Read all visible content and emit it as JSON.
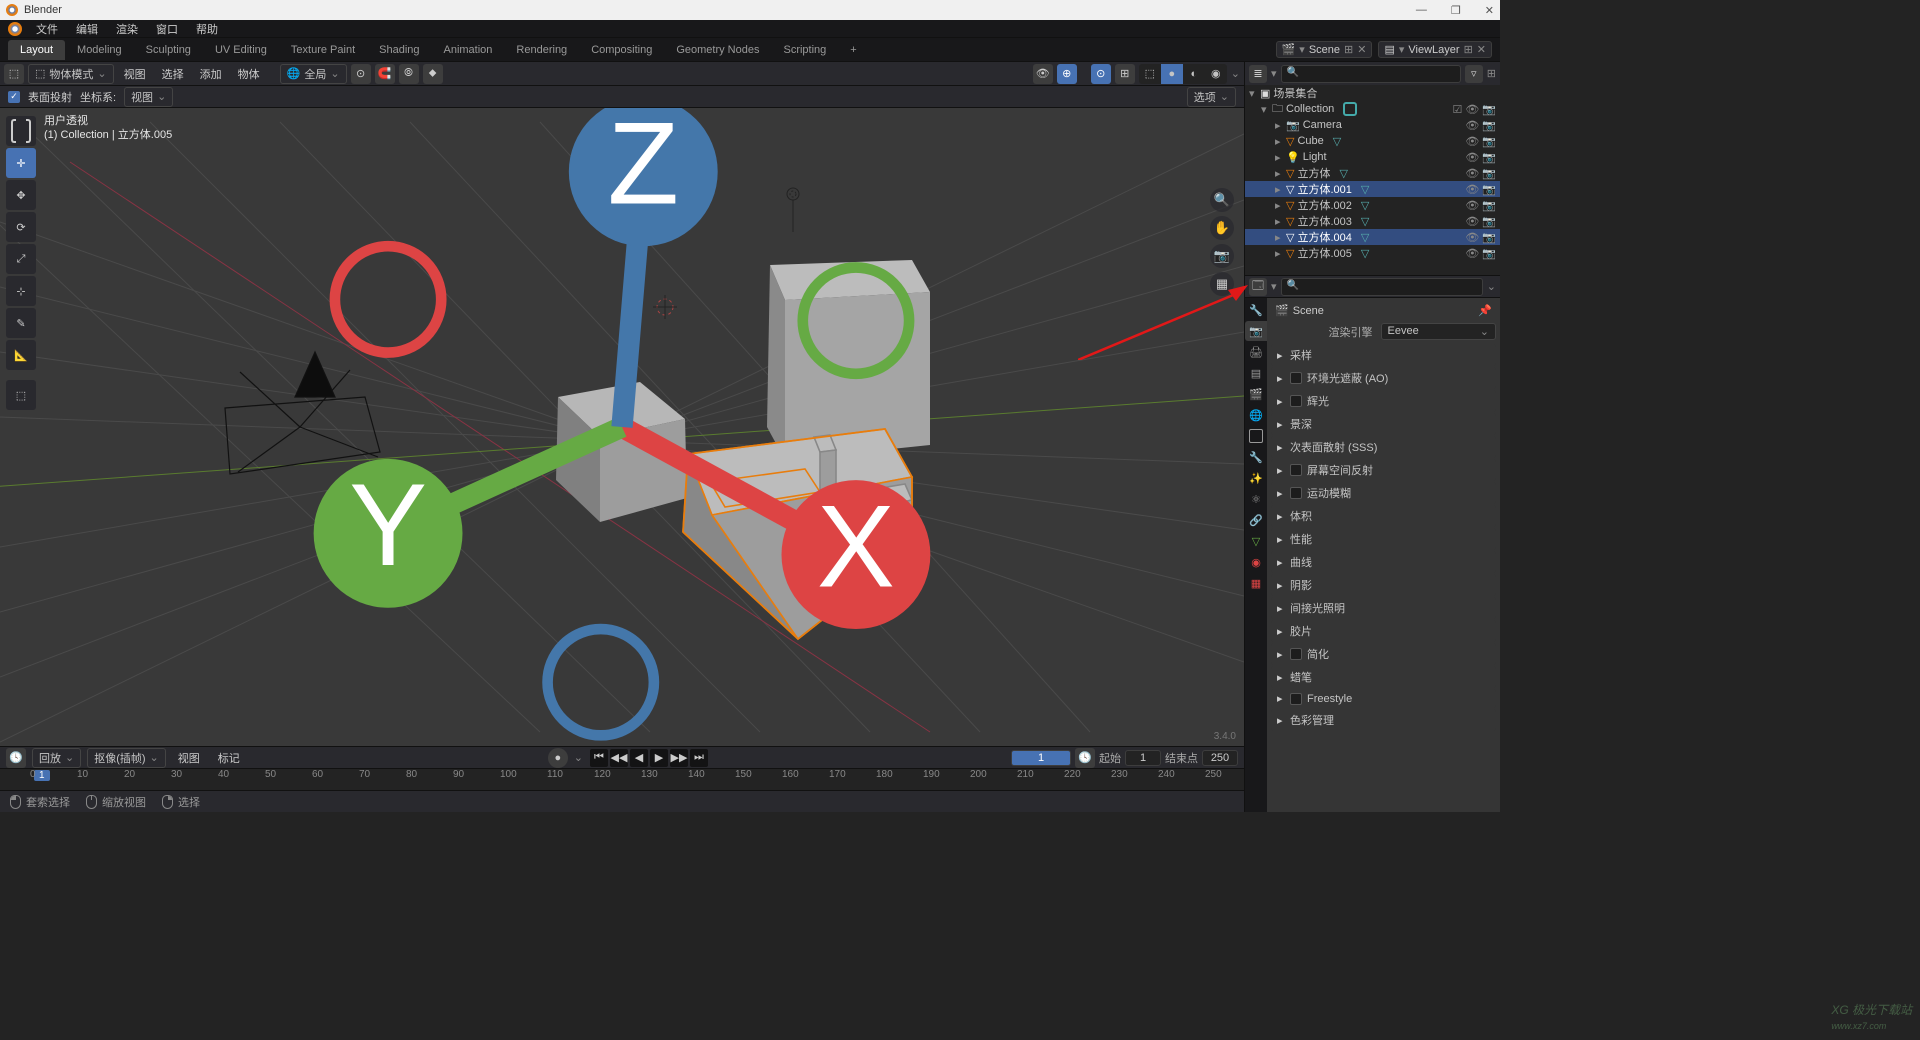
{
  "app_title": "Blender",
  "main_menu": [
    "文件",
    "编辑",
    "渲染",
    "窗口",
    "帮助"
  ],
  "workspace_tabs": {
    "active": "Layout",
    "items": [
      "Layout",
      "Modeling",
      "Sculpting",
      "UV Editing",
      "Texture Paint",
      "Shading",
      "Animation",
      "Rendering",
      "Compositing",
      "Geometry Nodes",
      "Scripting"
    ]
  },
  "scene_name": "Scene",
  "view_layer": "ViewLayer",
  "viewport_header": {
    "mode": "物体模式",
    "menus": [
      "视图",
      "选择",
      "添加",
      "物体"
    ],
    "orientation": "全局"
  },
  "viewport_opts": {
    "project_surface": "表面投射",
    "coord_label": "坐标系:",
    "coord_value": "视图",
    "options_label": "选项"
  },
  "toolbar": [
    "select-box",
    "cursor",
    "move",
    "rotate",
    "scale",
    "transform",
    "annotate",
    "measure",
    "add-primitive"
  ],
  "viewport_info": {
    "line1": "用户透视",
    "line2": "(1) Collection | 立方体.005"
  },
  "gizmo_axes": {
    "x": "X",
    "y": "Y",
    "z": "Z"
  },
  "outliner": {
    "root": "场景集合",
    "collection": "Collection",
    "items": [
      {
        "name": "Camera",
        "type": "camera",
        "selected": false
      },
      {
        "name": "Cube",
        "type": "mesh",
        "selected": false
      },
      {
        "name": "Light",
        "type": "light",
        "selected": false
      },
      {
        "name": "立方体",
        "type": "mesh",
        "selected": false
      },
      {
        "name": "立方体.001",
        "type": "mesh",
        "selected": true
      },
      {
        "name": "立方体.002",
        "type": "mesh",
        "selected": false
      },
      {
        "name": "立方体.003",
        "type": "mesh",
        "selected": false
      },
      {
        "name": "立方体.004",
        "type": "mesh",
        "selected": true
      },
      {
        "name": "立方体.005",
        "type": "mesh",
        "selected": false
      }
    ]
  },
  "properties": {
    "breadcrumb": "Scene",
    "render_engine_label": "渲染引擎",
    "render_engine_value": "Eevee",
    "panels": [
      {
        "label": "采样",
        "check": false
      },
      {
        "label": "环境光遮蔽 (AO)",
        "check": true
      },
      {
        "label": "辉光",
        "check": true
      },
      {
        "label": "景深",
        "check": false
      },
      {
        "label": "次表面散射 (SSS)",
        "check": false
      },
      {
        "label": "屏幕空间反射",
        "check": true
      },
      {
        "label": "运动模糊",
        "check": true
      },
      {
        "label": "体积",
        "check": false
      },
      {
        "label": "性能",
        "check": false
      },
      {
        "label": "曲线",
        "check": false
      },
      {
        "label": "阴影",
        "check": false
      },
      {
        "label": "间接光照明",
        "check": false
      },
      {
        "label": "胶片",
        "check": false
      },
      {
        "label": "简化",
        "check": true
      },
      {
        "label": "蜡笔",
        "check": false
      },
      {
        "label": "Freestyle",
        "check": true
      },
      {
        "label": "色彩管理",
        "check": false
      }
    ]
  },
  "timeline": {
    "playback": "回放",
    "keying": "抠像(插帧)",
    "menus": [
      "视图",
      "标记"
    ],
    "cur_frame": "1",
    "start_label": "起始",
    "start_frame": "1",
    "end_label": "结束点",
    "end_frame": "250",
    "ticks": [
      "0",
      "10",
      "20",
      "30",
      "40",
      "50",
      "60",
      "70",
      "80",
      "90",
      "100",
      "110",
      "120",
      "130",
      "140",
      "150",
      "160",
      "170",
      "180",
      "190",
      "200",
      "210",
      "220",
      "230",
      "240",
      "250"
    ]
  },
  "status_bar": {
    "select": "套索选择",
    "rotate": "缩放视图",
    "menu": "选择"
  },
  "version": "3.4.0"
}
